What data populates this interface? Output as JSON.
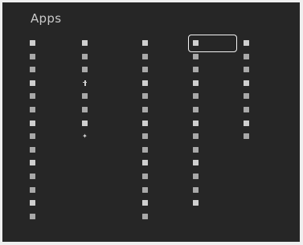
{
  "screen": {
    "title": "Apps"
  },
  "columns": [
    {
      "id": "col1",
      "header": "",
      "items": [
        {
          "label": "",
          "icon": "app-tile-icon"
        },
        {
          "label": "",
          "icon": "app-tile-icon"
        },
        {
          "label": "",
          "icon": "app-tile-icon"
        },
        {
          "label": "",
          "icon": "app-tile-icon"
        },
        {
          "label": "",
          "icon": "app-tile-icon"
        },
        {
          "label": "",
          "icon": "app-tile-icon"
        },
        {
          "label": "",
          "icon": "app-tile-icon"
        },
        {
          "label": "",
          "icon": "app-tile-icon"
        },
        {
          "label": "",
          "icon": "app-tile-icon"
        },
        {
          "label": "",
          "icon": "app-tile-icon"
        },
        {
          "label": "",
          "icon": "app-tile-icon"
        },
        {
          "label": "",
          "icon": "app-tile-icon"
        },
        {
          "label": "",
          "icon": "app-tile-icon"
        },
        {
          "label": "",
          "icon": "app-tile-icon"
        }
      ]
    },
    {
      "id": "col2",
      "header": "",
      "items": [
        {
          "label": "",
          "icon": "app-tile-icon"
        },
        {
          "label": "",
          "icon": "app-tile-icon"
        },
        {
          "label": "",
          "icon": "app-tile-icon"
        },
        {
          "label": "",
          "icon": "cross-icon"
        },
        {
          "label": "",
          "icon": "app-tile-icon"
        },
        {
          "label": "",
          "icon": "app-tile-icon"
        },
        {
          "label": "",
          "icon": "app-tile-icon"
        },
        {
          "label": "",
          "icon": "star-icon"
        }
      ]
    },
    {
      "id": "col3",
      "header": "",
      "items": [
        {
          "label": "",
          "icon": "app-tile-icon"
        },
        {
          "label": "",
          "icon": "app-tile-icon"
        },
        {
          "label": "",
          "icon": "app-tile-icon"
        },
        {
          "label": "",
          "icon": "app-tile-icon"
        },
        {
          "label": "",
          "icon": "app-tile-icon"
        },
        {
          "label": "",
          "icon": "app-tile-icon"
        },
        {
          "label": "",
          "icon": "app-tile-icon"
        },
        {
          "label": "",
          "icon": "app-tile-icon"
        },
        {
          "label": "",
          "icon": "app-tile-icon"
        },
        {
          "label": "",
          "icon": "app-tile-icon"
        },
        {
          "label": "",
          "icon": "app-tile-icon"
        },
        {
          "label": "",
          "icon": "app-tile-icon"
        },
        {
          "label": "",
          "icon": "app-tile-icon"
        },
        {
          "label": "",
          "icon": "app-tile-icon"
        }
      ]
    },
    {
      "id": "col4",
      "header": "",
      "items": [
        {
          "label": "",
          "icon": "app-tile-icon",
          "selected": true
        },
        {
          "label": "",
          "icon": "app-tile-icon"
        },
        {
          "label": "",
          "icon": "app-tile-icon"
        },
        {
          "label": "",
          "icon": "app-tile-icon"
        },
        {
          "label": "",
          "icon": "app-tile-icon"
        },
        {
          "label": "",
          "icon": "app-tile-icon"
        },
        {
          "label": "",
          "icon": "app-tile-icon"
        },
        {
          "label": "",
          "icon": "app-tile-icon"
        },
        {
          "label": "",
          "icon": "app-tile-icon"
        },
        {
          "label": "",
          "icon": "app-tile-icon"
        },
        {
          "label": "",
          "icon": "app-tile-icon"
        },
        {
          "label": "",
          "icon": "app-tile-icon"
        },
        {
          "label": "",
          "icon": "app-tile-icon"
        }
      ]
    },
    {
      "id": "col5",
      "header": "",
      "items": [
        {
          "label": "",
          "icon": "app-tile-icon"
        },
        {
          "label": "",
          "icon": "app-tile-icon"
        },
        {
          "label": "",
          "icon": "app-tile-icon"
        },
        {
          "label": "",
          "icon": "app-tile-icon"
        },
        {
          "label": "",
          "icon": "app-tile-icon"
        },
        {
          "label": "",
          "icon": "app-tile-icon"
        },
        {
          "label": "",
          "icon": "app-tile-icon"
        },
        {
          "label": "",
          "icon": "app-tile-icon"
        }
      ]
    }
  ],
  "colors": {
    "background": "#262626",
    "label": "#8a8a8a",
    "title": "#c9c9c9",
    "selection_border": "#f2f2f2"
  }
}
